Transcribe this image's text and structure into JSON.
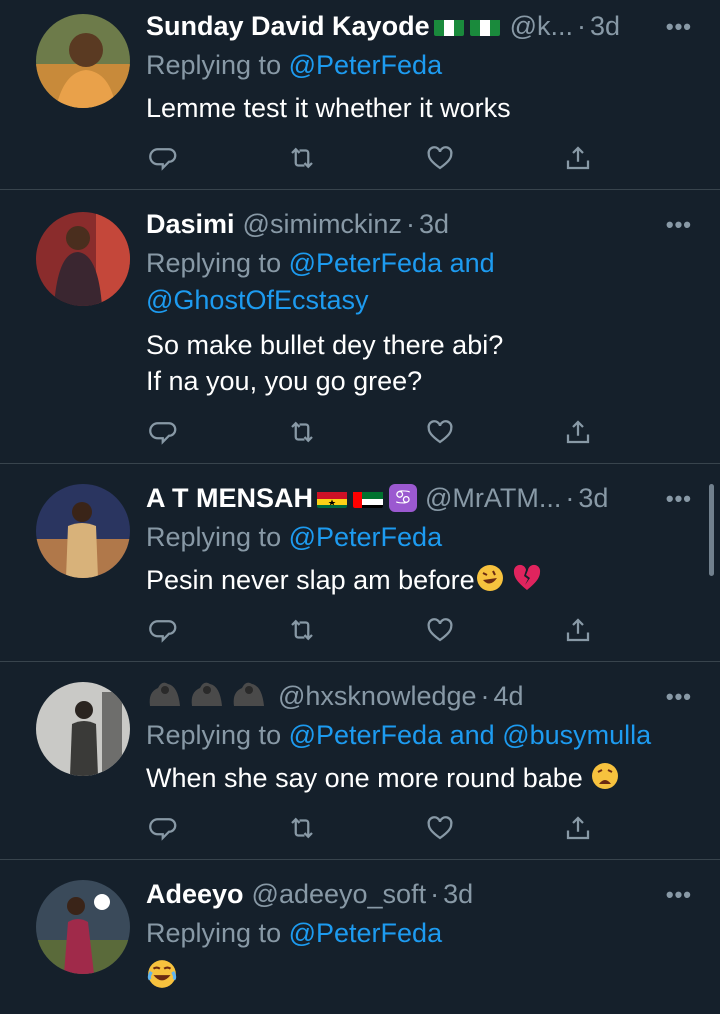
{
  "tweets": [
    {
      "name": "Sunday David Kayode",
      "flags": [
        "nigeria",
        "nigeria"
      ],
      "handle": "@k...",
      "time": "3d",
      "replying_prefix": "Replying to",
      "mentions": [
        "@PeterFeda"
      ],
      "lines": [
        "Lemme test it whether it works"
      ]
    },
    {
      "name": "Dasimi",
      "handle": "@simimckinz",
      "time": "3d",
      "replying_prefix": "Replying to",
      "mentions": [
        "@PeterFeda",
        "@GhostOfEcstasy"
      ],
      "and": "and",
      "lines": [
        "So make bullet dey there abi?",
        "If na you, you go gree?"
      ]
    },
    {
      "name": "A T MENSAH",
      "flags": [
        "ghana",
        "uae",
        "cancer"
      ],
      "handle": "@MrATM...",
      "time": "3d",
      "replying_prefix": "Replying to",
      "mentions": [
        "@PeterFeda"
      ],
      "lines": [
        "Pesin never slap am before"
      ],
      "emojis": [
        "rolling-laughing",
        "broken-heart"
      ]
    },
    {
      "name": "",
      "name_emojis": [
        "gorilla",
        "gorilla",
        "gorilla"
      ],
      "handle": "@hxsknowledge",
      "time": "4d",
      "replying_prefix": "Replying to",
      "mentions": [
        "@PeterFeda",
        "@busymulla"
      ],
      "and": "and",
      "lines": [
        "When she say one more round babe"
      ],
      "emojis": [
        "weary-face"
      ]
    },
    {
      "name": "Adeeyo",
      "handle": "@adeeyo_soft",
      "time": "3d",
      "replying_prefix": "Replying to",
      "mentions": [
        "@PeterFeda"
      ],
      "lines": [
        ""
      ],
      "emojis": [
        "joy-face"
      ]
    }
  ],
  "more_label": "•••",
  "dot": "·",
  "icons": [
    "reply-icon",
    "retweet-icon",
    "like-icon",
    "share-icon"
  ],
  "colors": {
    "background": "#15202b",
    "secondary": "#8899a6",
    "link": "#1d9bf0",
    "divider": "#38444d"
  }
}
